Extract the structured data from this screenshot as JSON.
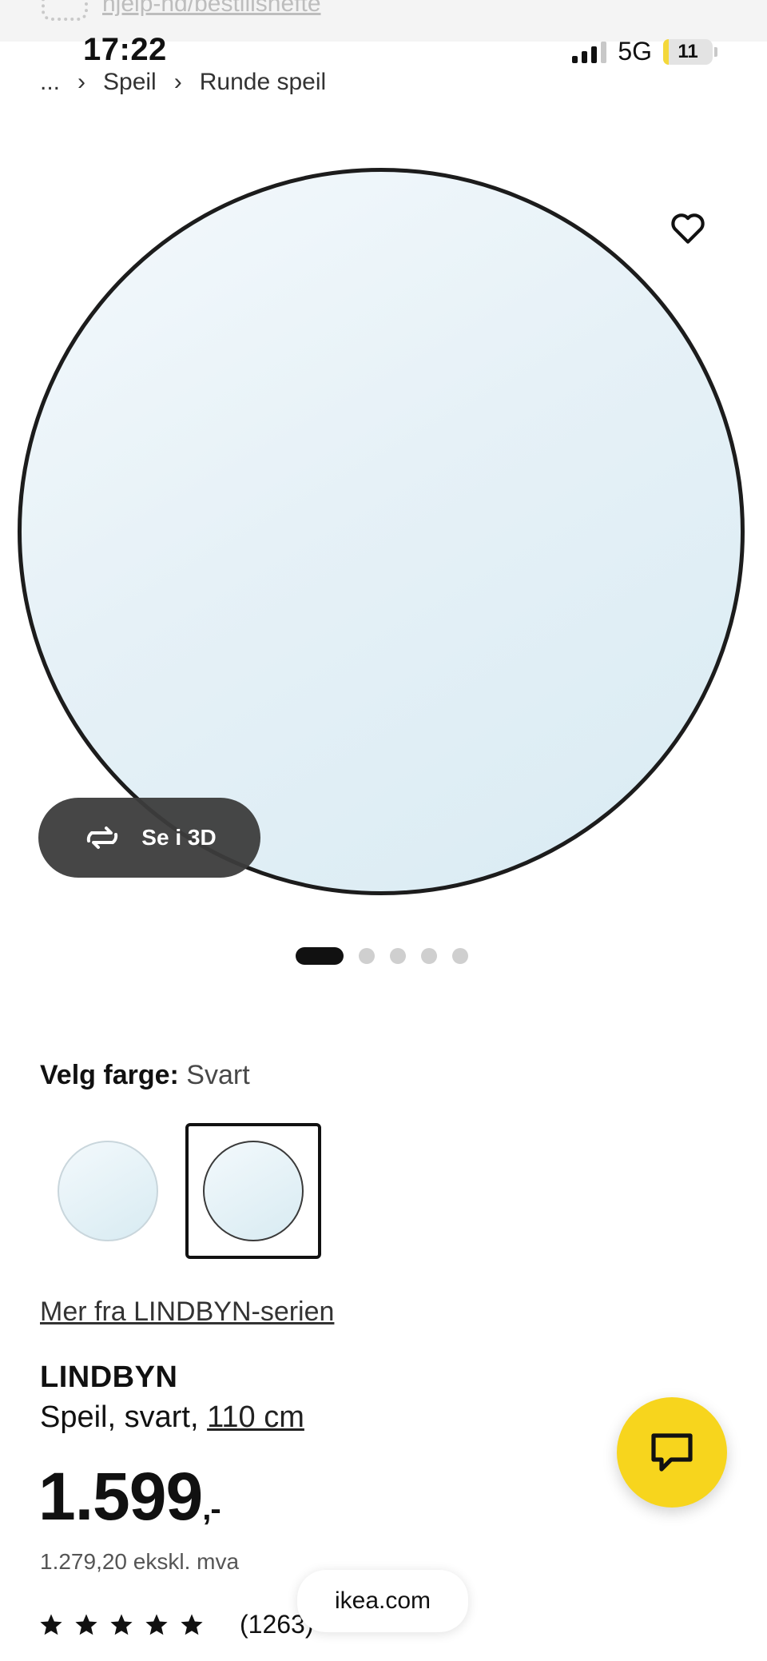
{
  "browser": {
    "url": "hjelp-hd/bestillshefte"
  },
  "status_bar": {
    "time": "17:22",
    "network": "5G",
    "battery": "11"
  },
  "breadcrumb": {
    "ellipsis": "...",
    "items": [
      "Speil",
      "Runde speil"
    ]
  },
  "gallery": {
    "view_3d_label": "Se i 3D",
    "total_images": 5,
    "active_index": 0
  },
  "color_picker": {
    "label": "Velg farge:",
    "selected": "Svart",
    "options": [
      "light",
      "Svart"
    ]
  },
  "series_link": "Mer fra LINDBYN-serien",
  "product": {
    "name": "LINDBYN",
    "description": "Speil, svart,",
    "size": "110 cm",
    "price": "1.599",
    "price_suffix": ",-",
    "price_ex_vat": "1.279,20 ekskl. mva",
    "rating_stars": 5,
    "review_count": "(1263)"
  },
  "footer": {
    "domain": "ikea.com"
  },
  "colors": {
    "accent_chat": "#f7d51d",
    "text": "#111111"
  }
}
